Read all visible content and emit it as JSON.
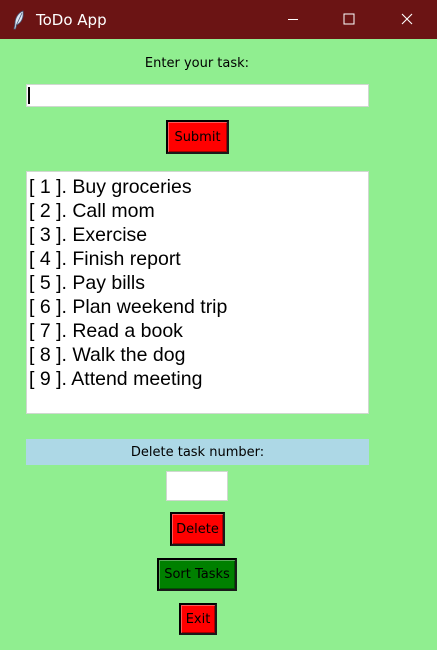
{
  "window": {
    "title": "ToDo App",
    "icons": [
      "feather-icon",
      "minimize-icon",
      "maximize-icon",
      "close-icon"
    ]
  },
  "input_section": {
    "label": "Enter your task:",
    "value": "",
    "submit_label": "Submit"
  },
  "tasks": [
    "[ 1 ]. Buy groceries",
    "[ 2 ]. Call mom",
    "[ 3 ]. Exercise",
    "[ 4 ]. Finish report",
    "[ 5 ]. Pay bills",
    "[ 6 ]. Plan weekend trip",
    "[ 7 ]. Read a book",
    "[ 8 ]. Walk the dog",
    "[ 9 ]. Attend meeting"
  ],
  "delete_section": {
    "label": "Delete task number:",
    "value": "",
    "delete_label": "Delete"
  },
  "sort_label": "Sort Tasks",
  "exit_label": "Exit",
  "colors": {
    "background": "#90ee90",
    "titlebar": "#6b1414",
    "red_button": "#ff0000",
    "green_button": "#008000",
    "delete_label_bg": "#add8e6"
  }
}
